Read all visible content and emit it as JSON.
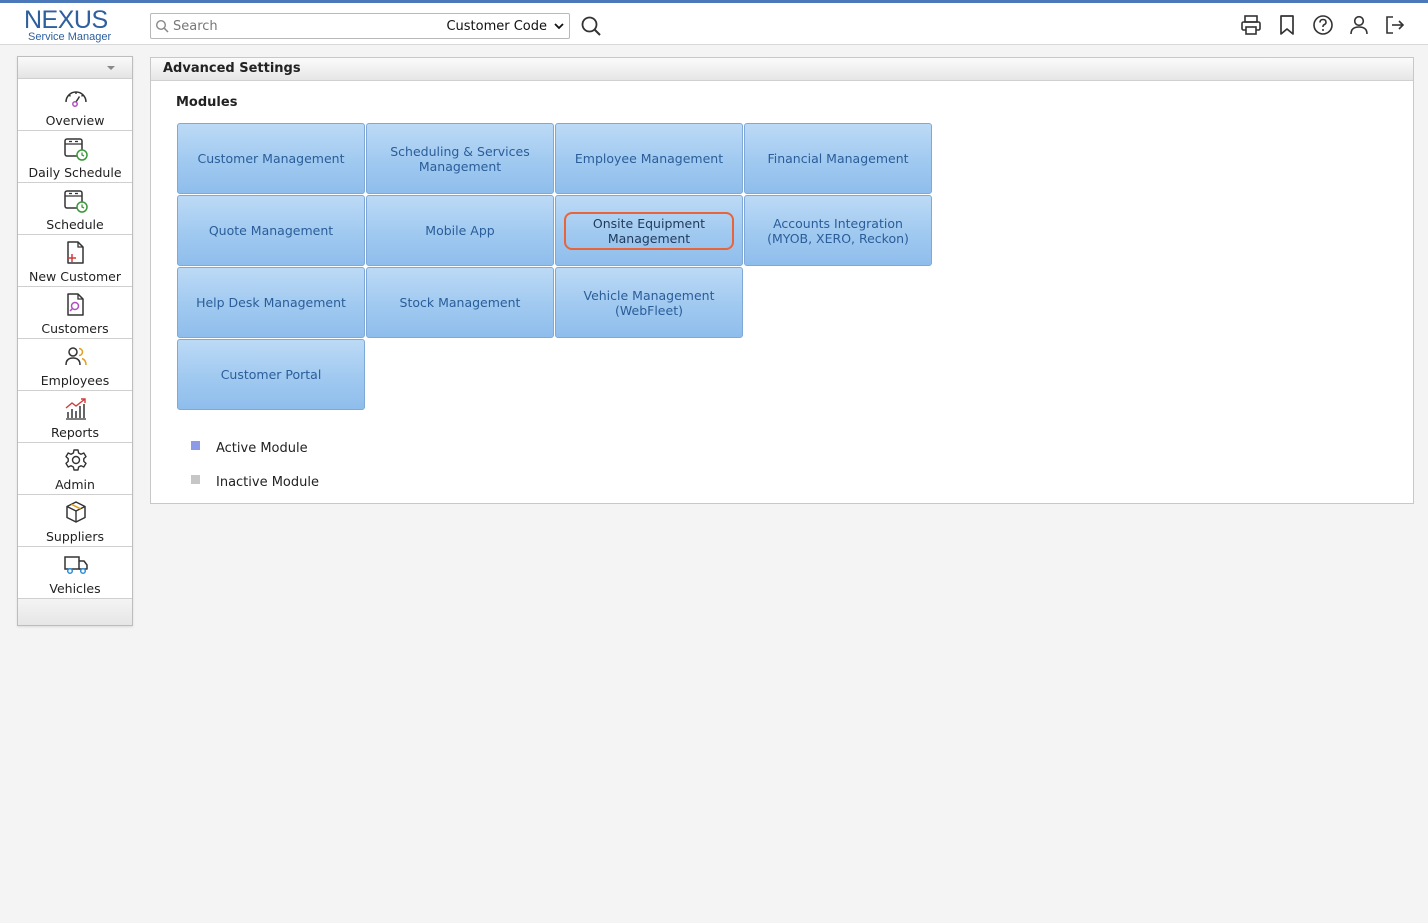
{
  "header": {
    "logo_main": "NEXUS",
    "logo_sub": "Service Manager",
    "search_placeholder": "Search",
    "search_field": "Customer Code"
  },
  "sidebar": {
    "items": [
      {
        "label": "Overview",
        "icon": "gauge-icon"
      },
      {
        "label": "Daily Schedule",
        "icon": "calendar-clock-icon"
      },
      {
        "label": "Schedule",
        "icon": "calendar-clock-icon"
      },
      {
        "label": "New Customer",
        "icon": "document-plus-icon"
      },
      {
        "label": "Customers",
        "icon": "document-search-icon"
      },
      {
        "label": "Employees",
        "icon": "users-icon"
      },
      {
        "label": "Reports",
        "icon": "chart-icon"
      },
      {
        "label": "Admin",
        "icon": "gear-icon"
      },
      {
        "label": "Suppliers",
        "icon": "box-icon"
      },
      {
        "label": "Vehicles",
        "icon": "truck-icon"
      }
    ]
  },
  "panel": {
    "title": "Advanced Settings",
    "modules_title": "Modules",
    "modules": [
      {
        "label": "Customer Management"
      },
      {
        "label": "Scheduling & Services Management"
      },
      {
        "label": "Employee Management"
      },
      {
        "label": "Financial Management"
      },
      {
        "label": "Quote Management"
      },
      {
        "label": "Mobile App"
      },
      {
        "label": "Onsite Equipment Management"
      },
      {
        "label": "Accounts Integration (MYOB, XERO, Reckon)"
      },
      {
        "label": "Help Desk Management"
      },
      {
        "label": "Stock Management"
      },
      {
        "label": "Vehicle Management (WebFleet)"
      },
      {
        "label": "Customer Portal"
      }
    ],
    "legend": {
      "active": "Active Module",
      "inactive": "Inactive Module"
    }
  },
  "colors": {
    "brand": "#2e5f9e",
    "module_bg": "#a0c9f0",
    "module_text": "#2a5d99",
    "highlight": "#e8643a",
    "active_square": "#8c9ae8",
    "inactive_square": "#c6c6c6"
  }
}
